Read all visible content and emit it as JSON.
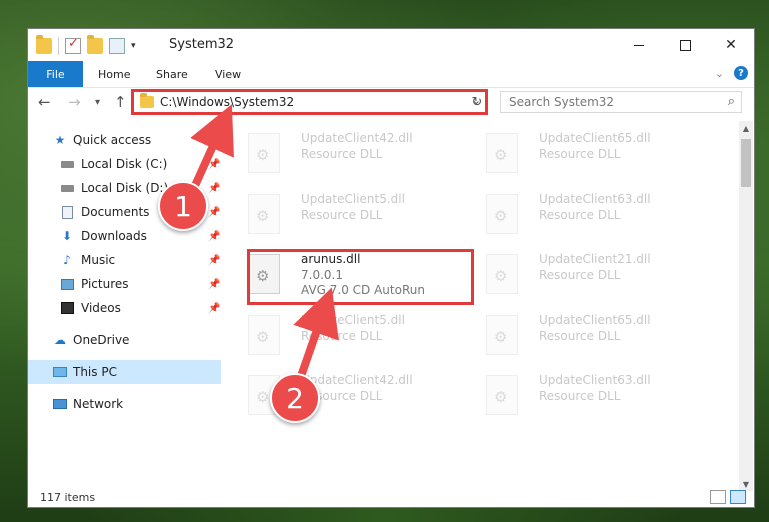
{
  "window": {
    "title": "System32",
    "controls": {
      "minimize": "",
      "maximize": "",
      "close": "✕"
    }
  },
  "quick_access": {
    "dropdown": "▾"
  },
  "ribbon": {
    "file": "File",
    "tabs": [
      "Home",
      "Share",
      "View"
    ],
    "help": "?"
  },
  "navbar": {
    "back": "←",
    "forward": "→",
    "recent": "▾",
    "up": "↑",
    "address": "C:\\Windows\\System32",
    "search_placeholder": "Search System32"
  },
  "sidebar": {
    "items": [
      {
        "label": "Quick access",
        "icon": "star-icon",
        "pinned": false
      },
      {
        "label": "Local Disk (C:)",
        "icon": "drive-icon",
        "pinned": true
      },
      {
        "label": "Local Disk (D:)",
        "icon": "drive-icon",
        "pinned": true
      },
      {
        "label": "Documents",
        "icon": "documents-icon",
        "pinned": true
      },
      {
        "label": "Downloads",
        "icon": "download-icon",
        "pinned": true
      },
      {
        "label": "Music",
        "icon": "music-icon",
        "pinned": true
      },
      {
        "label": "Pictures",
        "icon": "pictures-icon",
        "pinned": true
      },
      {
        "label": "Videos",
        "icon": "videos-icon",
        "pinned": true
      },
      {
        "label": "OneDrive",
        "icon": "cloud-icon",
        "pinned": false
      },
      {
        "label": "This PC",
        "icon": "computer-icon",
        "pinned": false,
        "selected": true
      },
      {
        "label": "Network",
        "icon": "network-icon",
        "pinned": false
      }
    ]
  },
  "files": [
    {
      "name": "UpdateClient42.dll",
      "line1": "Resource DLL"
    },
    {
      "name": "UpdateClient65.dll",
      "line1": "Resource DLL"
    },
    {
      "name": "UpdateClient5.dll",
      "line1": "Resource DLL"
    },
    {
      "name": "UpdateClient63.dll",
      "line1": "Resource DLL"
    },
    {
      "name": "arunus.dll",
      "line1": "7.0.0.1",
      "line2": "AVG 7.0 CD AutoRun",
      "highlighted": true
    },
    {
      "name": "UpdateClient21.dll",
      "line1": "Resource DLL"
    },
    {
      "name": "UpdateClient5.dll",
      "line1": "Resource DLL"
    },
    {
      "name": "UpdateClient65.dll",
      "line1": "Resource DLL"
    },
    {
      "name": "UpdateClient42.dll",
      "line1": "Resource DLL"
    },
    {
      "name": "UpdateClient63.dll",
      "line1": "Resource DLL"
    }
  ],
  "status": {
    "count": "117 items"
  },
  "annotations": {
    "step1": "1",
    "step2": "2"
  },
  "colors": {
    "accent": "#1979ca",
    "highlight": "#e03a3a",
    "badge": "#ec4b4b",
    "selected": "#cce8ff"
  }
}
